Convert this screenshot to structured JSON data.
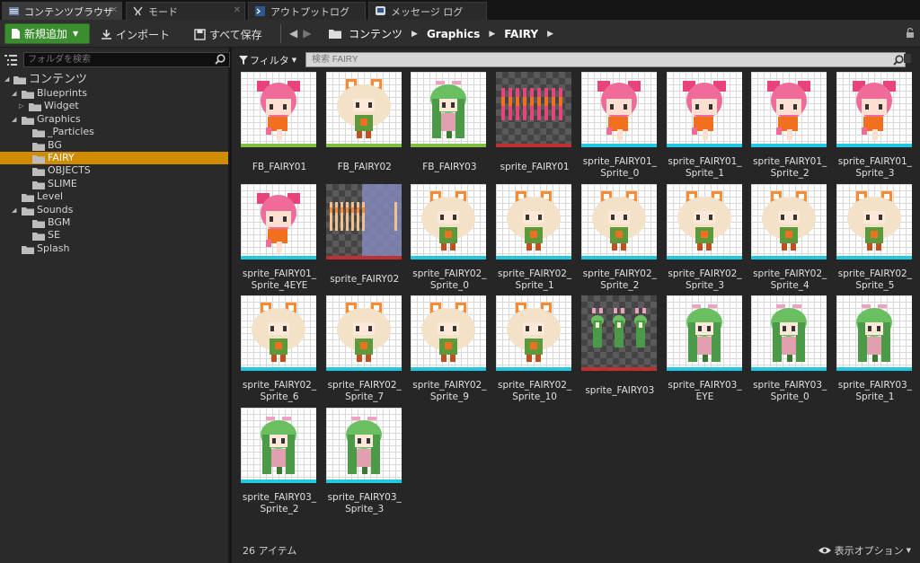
{
  "tabs": [
    {
      "label": "コンテンツブラウザ",
      "icon": "content-browser-icon"
    },
    {
      "label": "モード",
      "icon": "modes-icon"
    },
    {
      "label": "アウトプットログ",
      "icon": "output-log-icon"
    },
    {
      "label": "メッセージ ログ",
      "icon": "message-log-icon"
    }
  ],
  "toolbar": {
    "add_new": "新規追加",
    "import": "インポート",
    "save_all": "すべて保存"
  },
  "breadcrumb": [
    "コンテンツ",
    "Graphics",
    "FAIRY"
  ],
  "folder_search": {
    "placeholder": "フォルダを検索"
  },
  "tree": {
    "root": "コンテンツ",
    "items": [
      "Blueprints",
      "Widget",
      "Graphics",
      "_Particles",
      "BG",
      "FAIRY",
      "OBJECTS",
      "SLIME",
      "Level",
      "Sounds",
      "BGM",
      "SE",
      "Splash"
    ]
  },
  "filter": {
    "label": "フィルタ",
    "search_placeholder": "検索 FAIRY"
  },
  "assets": [
    {
      "name": "FB_FAIRY01",
      "kind": "flipbook",
      "char": "pink"
    },
    {
      "name": "FB_FAIRY02",
      "kind": "flipbook",
      "char": "cream"
    },
    {
      "name": "FB_FAIRY03",
      "kind": "flipbook",
      "char": "green"
    },
    {
      "name": "sprite_FAIRY01",
      "kind": "texture",
      "char": "pink-sheet"
    },
    {
      "name": "sprite_FAIRY01_\nSprite_0",
      "kind": "sprite",
      "char": "pink"
    },
    {
      "name": "sprite_FAIRY01_\nSprite_1",
      "kind": "sprite",
      "char": "pink"
    },
    {
      "name": "sprite_FAIRY01_\nSprite_2",
      "kind": "sprite",
      "char": "pink"
    },
    {
      "name": "sprite_FAIRY01_\nSprite_3",
      "kind": "sprite",
      "char": "pink"
    },
    {
      "name": "sprite_FAIRY01_\nSprite_4EYE",
      "kind": "sprite",
      "char": "pink"
    },
    {
      "name": "sprite_FAIRY02",
      "kind": "texture",
      "char": "cream-sheet"
    },
    {
      "name": "sprite_FAIRY02_\nSprite_0",
      "kind": "sprite",
      "char": "cream"
    },
    {
      "name": "sprite_FAIRY02_\nSprite_1",
      "kind": "sprite",
      "char": "cream"
    },
    {
      "name": "sprite_FAIRY02_\nSprite_2",
      "kind": "sprite",
      "char": "cream"
    },
    {
      "name": "sprite_FAIRY02_\nSprite_3",
      "kind": "sprite",
      "char": "cream"
    },
    {
      "name": "sprite_FAIRY02_\nSprite_4",
      "kind": "sprite",
      "char": "cream"
    },
    {
      "name": "sprite_FAIRY02_\nSprite_5",
      "kind": "sprite",
      "char": "cream"
    },
    {
      "name": "sprite_FAIRY02_\nSprite_6",
      "kind": "sprite",
      "char": "cream"
    },
    {
      "name": "sprite_FAIRY02_\nSprite_7",
      "kind": "sprite",
      "char": "cream"
    },
    {
      "name": "sprite_FAIRY02_\nSprite_9",
      "kind": "sprite",
      "char": "cream"
    },
    {
      "name": "sprite_FAIRY02_\nSprite_10",
      "kind": "sprite",
      "char": "cream"
    },
    {
      "name": "sprite_FAIRY03",
      "kind": "texture",
      "char": "green-sheet"
    },
    {
      "name": "sprite_FAIRY03_\nEYE",
      "kind": "sprite",
      "char": "green"
    },
    {
      "name": "sprite_FAIRY03_\nSprite_0",
      "kind": "sprite",
      "char": "green"
    },
    {
      "name": "sprite_FAIRY03_\nSprite_1",
      "kind": "sprite",
      "char": "green"
    },
    {
      "name": "sprite_FAIRY03_\nSprite_2",
      "kind": "sprite",
      "char": "green"
    },
    {
      "name": "sprite_FAIRY03_\nSprite_3",
      "kind": "sprite",
      "char": "green"
    }
  ],
  "status": {
    "item_count": "26 アイテム",
    "view_options": "表示オプション"
  },
  "colors": {
    "accent_green": "#3b8d2f",
    "selected_folder": "#d08c00",
    "flipbook_strip": "#7fbf3f",
    "texture_strip": "#c03030",
    "sprite_strip": "#22c7e0"
  }
}
